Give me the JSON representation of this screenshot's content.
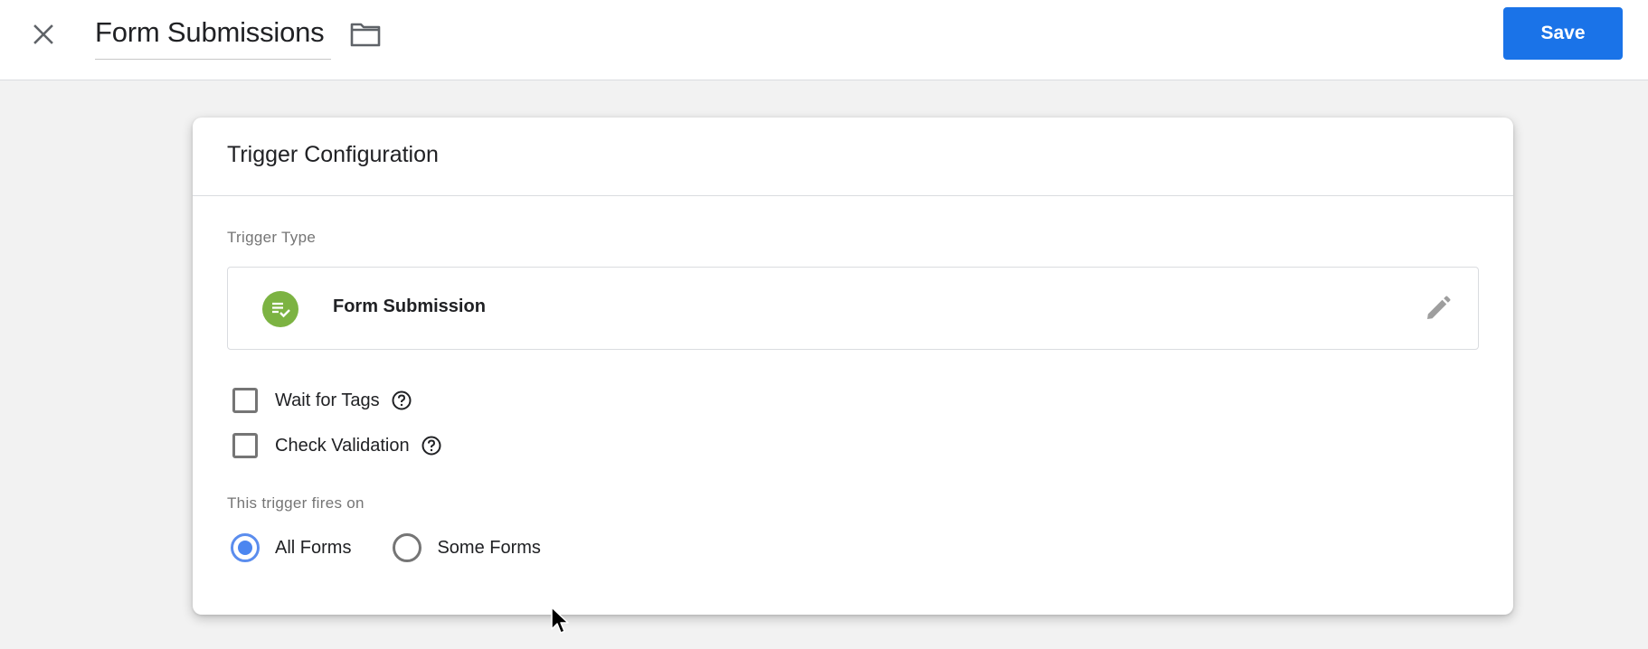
{
  "header": {
    "close_icon": "close-icon",
    "title": "Form Submissions",
    "folder_icon": "folder-icon",
    "save_label": "Save",
    "accent_color": "#1a73e8"
  },
  "card": {
    "title": "Trigger Configuration",
    "trigger_type": {
      "label": "Trigger Type",
      "name": "Form Submission",
      "icon": "form-check-icon",
      "icon_color": "#7cb342",
      "edit_icon": "pencil-icon"
    },
    "options": [
      {
        "label": "Wait for Tags",
        "checked": false,
        "help_icon": "help-circle-icon"
      },
      {
        "label": "Check Validation",
        "checked": false,
        "help_icon": "help-circle-icon"
      }
    ],
    "fires_on": {
      "label": "This trigger fires on",
      "choices": [
        {
          "label": "All Forms",
          "selected": true
        },
        {
          "label": "Some Forms",
          "selected": false
        }
      ],
      "selected_color": "#4c86f0"
    }
  }
}
